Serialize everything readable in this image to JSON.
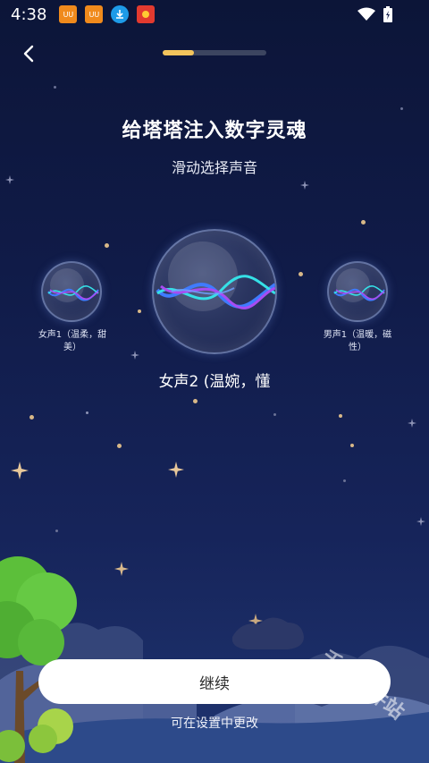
{
  "status_bar": {
    "time": "4:38",
    "notifications": [
      {
        "icon": "uu-booster-icon",
        "color": "#f08a1c"
      },
      {
        "icon": "uu-booster-icon",
        "color": "#f08a1c"
      },
      {
        "icon": "download-icon",
        "color": "#1e9be8"
      },
      {
        "icon": "app-badge-icon",
        "color": "#e23a2f"
      }
    ]
  },
  "header": {
    "progress": 0.3,
    "progress_color": "#f3c45c"
  },
  "main": {
    "title": "给塔塔注入数字灵魂",
    "subtitle": "滑动选择声音",
    "voices": [
      {
        "label_line1": "女声1（温柔，甜",
        "label_line2": "美）"
      },
      {
        "label": "女声2 (温婉，懂"
      },
      {
        "label_line1": "男声1（温暖，磁",
        "label_line2": "性）"
      }
    ]
  },
  "footer": {
    "continue_label": "继续",
    "hint": "可在设置中更改"
  },
  "watermark": "千条软件站",
  "colors": {
    "accent": "#f3c45c",
    "wave_blue": "#3f7bff",
    "wave_cyan": "#35e0e6",
    "wave_purple": "#a84cf2",
    "tree_green": "#5cbf3a"
  }
}
